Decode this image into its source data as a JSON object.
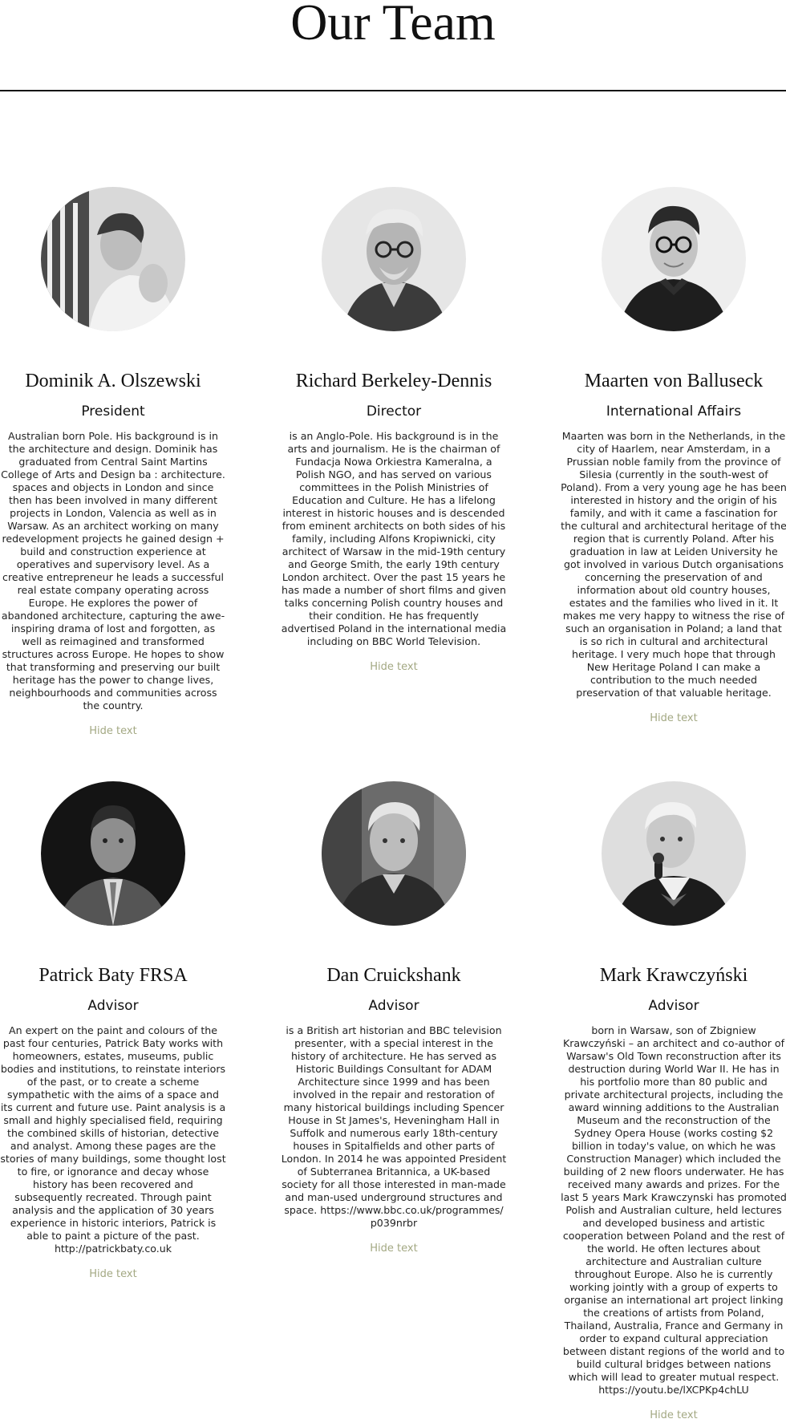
{
  "page": {
    "title": "Our Team"
  },
  "accent_color": "#a3a883",
  "members": [
    {
      "name": "Dominik A. Olszewski",
      "role": "President",
      "bio": "Australian born Pole. His background is in the architecture and design. Dominik has graduated from Central Saint Martins College of Arts and Design ba : architecture. spaces and objects in London and since then has been involved in many different projects in London, Valencia as well as in Warsaw. As an architect working on many redevelopment projects he gained design + build and construction experience at operatives and supervisory level. As a creative entrepreneur he leads a successful real estate company operating across Europe. He explores the power of abandoned architecture, capturing the awe-inspiring drama of lost and forgotten, as well as reimagined and transformed structures across Europe. He hopes to show that transforming and preserving our built heritage has the power to change lives, neighbourhoods and communities across the country.",
      "toggle": "Hide text",
      "photo_icon": "portrait-young-man"
    },
    {
      "name": "Richard Berkeley-Dennis",
      "role": "Director",
      "bio": "is an Anglo-Pole. His background is in the arts and journalism. He is the chairman of Fundacja Nowa Orkiestra Kameralna, a Polish NGO, and has served on various committees in the Polish Ministries of Education and Culture. He has a lifelong interest in historic houses and is descended from eminent architects on both sides of his family, including Alfons Kropiwnicki, city architect of Warsaw in the mid-19th century and George Smith, the early 19th century London architect. Over the past 15 years he has made a number of short films and given talks concerning Polish country houses and their condition. He has frequently advertised Poland in the international media including on BBC World Television.",
      "toggle": "Hide text",
      "photo_icon": "portrait-older-man-glasses"
    },
    {
      "name": "Maarten von Balluseck",
      "role": "International Affairs",
      "bio": "Maarten was born in the Netherlands, in the city of Haarlem, near Amsterdam, in a Prussian noble family from the province of Silesia (currently in the south-west of Poland). From a very young age he has been interested in history and the origin of his family, and with it came a fascination for the cultural and architectural heritage of the region that is currently Poland. After his graduation in law at Leiden University he got involved in various Dutch organisations concerning the preservation of and information about old country houses, estates and the families who lived in it. It makes me very happy to witness the rise of such an organisation in Poland; a land that is so rich in cultural and architectural heritage. I very much hope that through New Heritage Poland I can make a contribution to the much needed preservation of that valuable heritage.",
      "toggle": "Hide text",
      "photo_icon": "portrait-young-man-glasses"
    },
    {
      "name": "Patrick Baty FRSA",
      "role": "Advisor",
      "bio": "An expert on the paint and colours of the past four centuries, Patrick Baty works with homeowners, estates, museums, public bodies and institutions, to reinstate interiors of the past, or to create a scheme sympathetic with the aims of a space and its current and future use. Paint analysis is a small and highly specialised field, requiring the combined skills of historian, detective and analyst. Among these pages are the stories of many buildings, some thought lost to fire, or ignorance and decay whose history has been recovered and subsequently recreated. Through paint analysis and the application of 30 years experience in historic interiors, Patrick is able to paint a picture of the past. http://patrickbaty.co.uk",
      "toggle": "Hide text",
      "photo_icon": "portrait-man-suit"
    },
    {
      "name": "Dan Cruickshank",
      "role": "Advisor",
      "bio": "is a British art historian and BBC television presenter, with a special interest in the history of architecture. He has served as Historic Buildings Consultant for ADAM Architecture since 1999 and has been involved in the repair and restoration of many historical buildings including Spencer House in St James's, Heveningham Hall in Suffolk and numerous early 18th-century houses in Spitalfields and other parts of London. In 2014 he was appointed President of Subterranea Britannica, a UK-based society for all those interested in man-made and man-used underground structures and space. https://www.bbc.co.uk/programmes/ p039nrbr",
      "toggle": "Hide text",
      "photo_icon": "portrait-older-man"
    },
    {
      "name": "Mark Krawczyński",
      "role": "Advisor",
      "bio": "born in Warsaw, son of Zbigniew Krawczyński – an architect and co-author of Warsaw's Old Town reconstruction after its destruction during World War II. He has in his portfolio more than 80 public and private architectural projects, including the award winning additions to the Australian Museum and the reconstruction of the Sydney Opera House (works costing $2 billion in today's value, on which he was Construction Manager) which included the building of 2 new floors underwater. He has received many awards and prizes. For the last 5 years Mark Krawczynski has promoted Polish and Australian culture, held lectures and developed business and artistic cooperation between Poland and the rest of the world. He often lectures about architecture and Australian culture throughout Europe. Also he is currently working jointly with a group of experts to organise an international art project linking the creations of artists from Poland, Thailand, Australia, France and Germany in order to expand cultural appreciation between distant regions of the world and to build cultural bridges between nations which will lead to greater mutual respect. https://youtu.be/lXCPKp4chLU",
      "toggle": "Hide text",
      "photo_icon": "portrait-man-microphone"
    }
  ]
}
